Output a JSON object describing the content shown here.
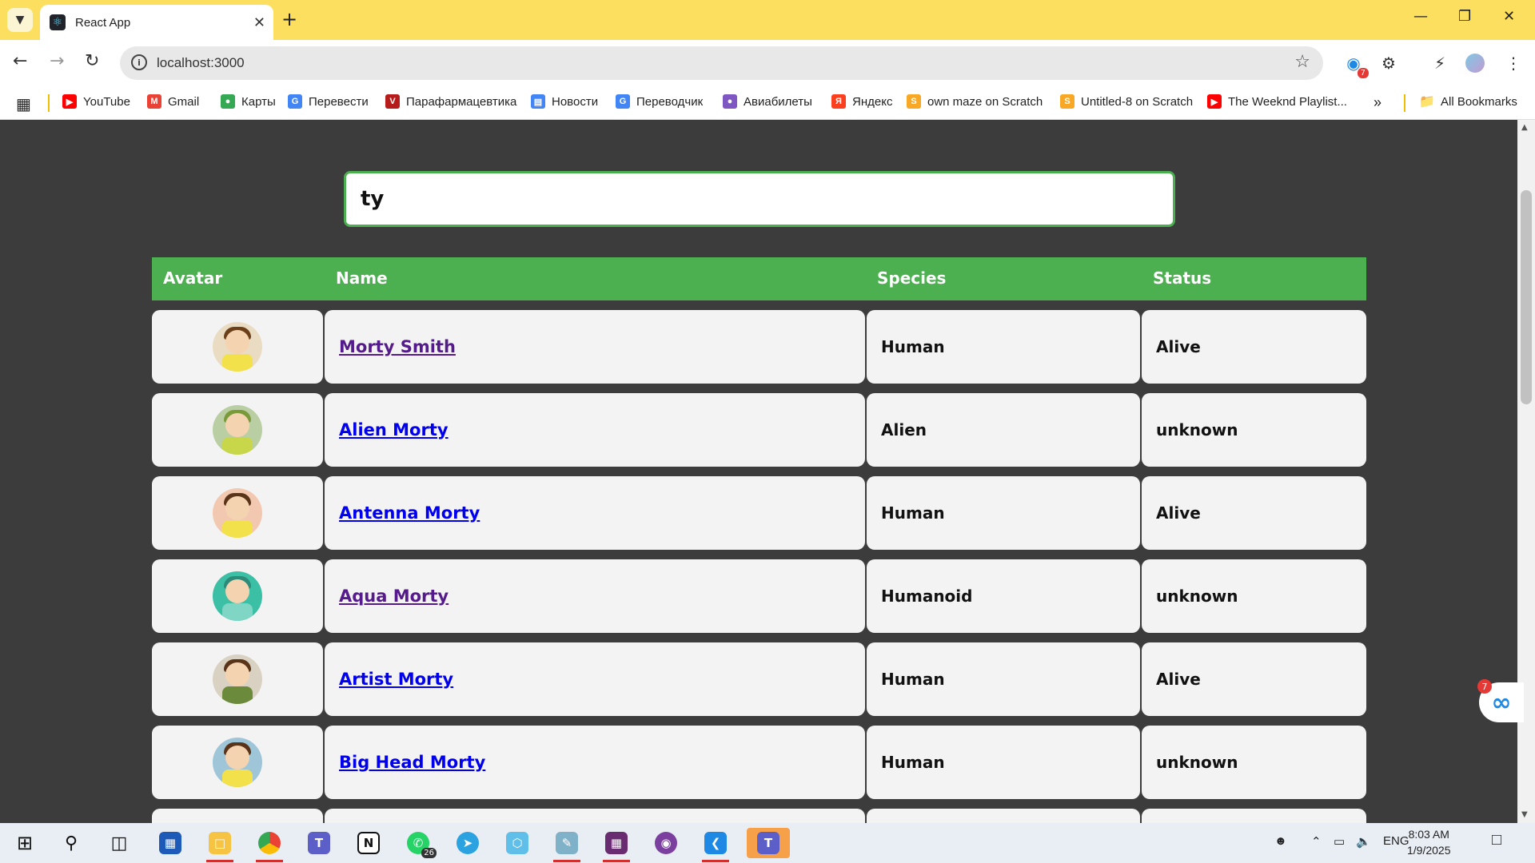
{
  "browser": {
    "tab_title": "React App",
    "url": "localhost:3000",
    "extension_badge": "7"
  },
  "bookmarks": [
    {
      "label": "YouTube",
      "icon": "youtube-icon",
      "color": "#ff0000"
    },
    {
      "label": "Gmail",
      "icon": "gmail-icon",
      "color": "#ea4335"
    },
    {
      "label": "Карты",
      "icon": "maps-pin-icon",
      "color": "#34a853"
    },
    {
      "label": "Перевести",
      "icon": "translate-icon",
      "color": "#4285f4"
    },
    {
      "label": "Парафармацевтика",
      "icon": "v-logo-icon",
      "color": "#b71c1c"
    },
    {
      "label": "Новости",
      "icon": "news-icon",
      "color": "#4285f4"
    },
    {
      "label": "Переводчик",
      "icon": "translate-icon",
      "color": "#4285f4"
    },
    {
      "label": "Авиабилеты",
      "icon": "globe-icon",
      "color": "#7e57c2"
    },
    {
      "label": "Яндекс",
      "icon": "yandex-icon",
      "color": "#fc3f1d"
    },
    {
      "label": "own maze on Scratch",
      "icon": "scratch-icon",
      "color": "#f9a825"
    },
    {
      "label": "Untitled-8 on Scratch",
      "icon": "scratch-icon",
      "color": "#f9a825"
    },
    {
      "label": "The Weeknd Playlist...",
      "icon": "youtube-icon",
      "color": "#ff0000"
    }
  ],
  "all_bookmarks": "All Bookmarks",
  "search": {
    "value": "ty"
  },
  "table": {
    "headers": [
      "Avatar",
      "Name",
      "Species",
      "Status"
    ],
    "rows": [
      {
        "name": "Morty Smith",
        "species": "Human",
        "status": "Alive",
        "visited": true,
        "hair": "#6b3f1a",
        "shirt": "#f2e14a",
        "bg": "#e9dcc2"
      },
      {
        "name": "Alien Morty",
        "species": "Alien",
        "status": "unknown",
        "visited": false,
        "hair": "#7a9a3a",
        "shirt": "#c8d64a",
        "bg": "#b9cfa3"
      },
      {
        "name": "Antenna Morty",
        "species": "Human",
        "status": "Alive",
        "visited": false,
        "hair": "#5a3418",
        "shirt": "#f2e14a",
        "bg": "#f3c8b0"
      },
      {
        "name": "Aqua Morty",
        "species": "Humanoid",
        "status": "unknown",
        "visited": true,
        "hair": "#2e8b7a",
        "shirt": "#7fd6c4",
        "bg": "#3bbfa5"
      },
      {
        "name": "Artist Morty",
        "species": "Human",
        "status": "Alive",
        "visited": false,
        "hair": "#5a3418",
        "shirt": "#6c8a3c",
        "bg": "#d9d2c3"
      },
      {
        "name": "Big Head Morty",
        "species": "Human",
        "status": "unknown",
        "visited": false,
        "hair": "#5a3418",
        "shirt": "#f2e14a",
        "bg": "#9fc6d8"
      }
    ]
  },
  "colors": {
    "accent": "#4caf50",
    "link": "#0000ee",
    "link_visited": "#551a8b",
    "page_bg": "#3c3c3c",
    "row_bg": "#f3f3f3"
  },
  "widget_badge": "7",
  "taskbar": {
    "whatsapp_badge": "26",
    "language": "ENG",
    "time": "8:03 AM",
    "date": "1/9/2025"
  }
}
